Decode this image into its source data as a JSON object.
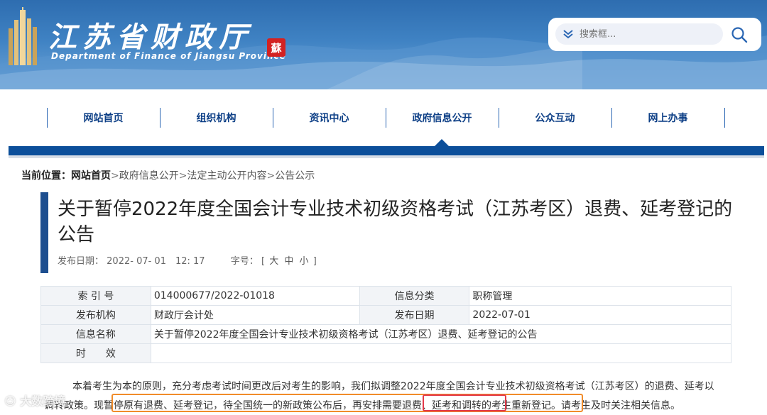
{
  "header": {
    "site_title": "江苏省财政厅",
    "site_subtitle": "Department of Finance of Jiangsu Province",
    "seal_char": "蘇",
    "search": {
      "placeholder": "搜索框..."
    }
  },
  "nav": {
    "items": [
      {
        "label": "网站首页"
      },
      {
        "label": "组织机构"
      },
      {
        "label": "资讯中心"
      },
      {
        "label": "政府信息公开"
      },
      {
        "label": "公众互动"
      },
      {
        "label": "网上办事"
      }
    ],
    "active_index": 3
  },
  "breadcrumb": {
    "label": "当前位置：",
    "home": "网站首页",
    "items": [
      "政府信息公开",
      "法定主动公开内容",
      "公告公示"
    ],
    "sep": ">"
  },
  "article": {
    "title": "关于暂停2022年度全国会计专业技术初级资格考试（江苏考区）退费、延考登记的公告",
    "publish_label": "发布日期：",
    "publish_datetime": "2022- 07- 01　12: 17",
    "font_label": "字号：",
    "font_sizes": {
      "open": "[",
      "large": "大",
      "medium": "中",
      "small": "小",
      "close": "]"
    }
  },
  "info_table": {
    "index_label": "索 引 号",
    "index_value": "014000677/2022-01018",
    "category_label": "信息分类",
    "category_value": "职称管理",
    "publisher_label": "发布机构",
    "publisher_value": "财政厅会计处",
    "date_label": "发布日期",
    "date_value": "2022-07-01",
    "name_label": "信息名称",
    "name_value": "关于暂停2022年度全国会计专业技术初级资格考试（江苏考区）退费、延考登记的公告",
    "validity_label": "时　　效",
    "validity_value": ""
  },
  "body": {
    "para1_a": "本着考生为本的原则，充分考虑考试时间更改后对考生的影响，我们拟调整2022年度全国会计专业技术初级资格考试（江苏考区）的退费、延考",
    "para1_b": "以调转政策。",
    "highlight_a": "现暂停原有退费、延考登记，待全国统一的新政策公布后，再安排需要",
    "highlight_red": "退费、延考和调转",
    "highlight_b": "的考生重新登记。",
    "tail": "请考生及时关注相关信息。"
  },
  "watermark": "大数跨境",
  "colors": {
    "banner": "#3f82c3",
    "nav_text": "#0d3f86",
    "nav_bar": "#0c4f9a",
    "title_accent": "#1d4e8f",
    "highlight_orange": "#f18c2a",
    "highlight_red": "#e33a4a"
  }
}
